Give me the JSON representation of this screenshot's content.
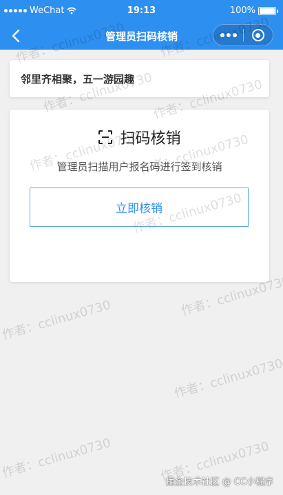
{
  "status_bar": {
    "carrier": "WeChat",
    "time": "19:13",
    "battery": "100%",
    "battery_level": 1.0
  },
  "nav": {
    "title": "管理员扫码核销",
    "back_icon": "chevron-left-icon",
    "more_icon": "more-dots-icon",
    "close_icon": "target-close-icon"
  },
  "event": {
    "name": "邻里齐相聚，五一游园趣"
  },
  "scan": {
    "icon": "scan-frame-icon",
    "title": "扫码核销",
    "description": "管理员扫描用户报名码进行签到核销",
    "button_label": "立即核销"
  },
  "watermark": {
    "text": "作者：cclinux0730"
  },
  "footer": {
    "credit": "掘金技术社区 @ CC小程序"
  }
}
